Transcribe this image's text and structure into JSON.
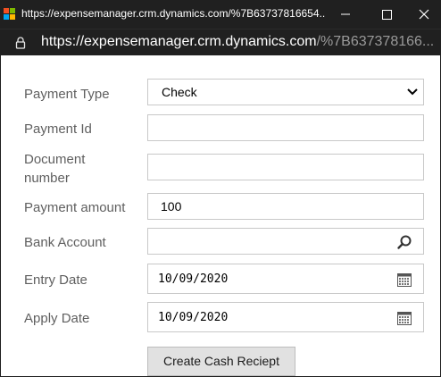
{
  "window": {
    "title": "https://expensemanager.crm.dynamics.com/%7B63737816654..."
  },
  "address": {
    "host": "https://expensemanager.crm.dynamics.com",
    "path": "/%7B637378166..."
  },
  "form": {
    "payment_type": {
      "label": "Payment Type",
      "value": "Check"
    },
    "payment_id": {
      "label": "Payment Id",
      "value": ""
    },
    "document_number": {
      "label_line1": "Document",
      "label_line2": "number",
      "value": ""
    },
    "payment_amount": {
      "label": "Payment amount",
      "value": "100"
    },
    "bank_account": {
      "label": "Bank Account",
      "value": ""
    },
    "entry_date": {
      "label": "Entry Date",
      "value": "10/09/2020"
    },
    "apply_date": {
      "label": "Apply Date",
      "value": "10/09/2020"
    },
    "submit_label": "Create Cash Reciept"
  },
  "icons": {
    "app": "microsoft-logo-icon",
    "minimize": "minimize-icon",
    "maximize": "maximize-icon",
    "close": "close-icon",
    "lock": "lock-icon",
    "dropdown": "chevron-down-icon",
    "search": "search-icon",
    "calendar": "calendar-icon"
  },
  "colors": {
    "titlebar": "#202020",
    "label": "#5f5f5f",
    "border": "#c8c8c8",
    "button": "#e1e1e1"
  }
}
